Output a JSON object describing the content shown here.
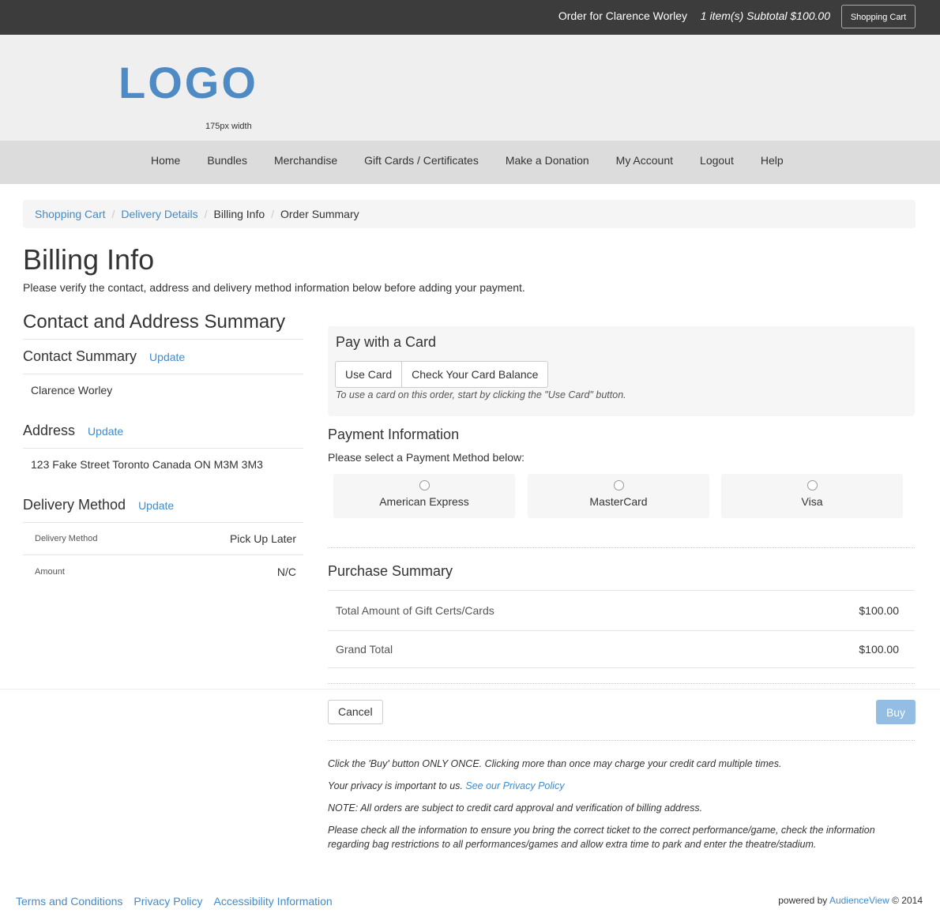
{
  "topbar": {
    "order_for": "Order for Clarence Worley",
    "subtotal": "1 item(s) Subtotal $100.00",
    "cart_button": "Shopping Cart"
  },
  "header": {
    "logo": "LOGO",
    "logo_note": "175px width"
  },
  "nav": {
    "items": [
      "Home",
      "Bundles",
      "Merchandise",
      "Gift Cards / Certificates",
      "Make a Donation",
      "My Account",
      "Logout",
      "Help"
    ]
  },
  "breadcrumb": {
    "items": [
      "Shopping Cart",
      "Delivery Details",
      "Billing Info",
      "Order Summary"
    ],
    "separator": "/"
  },
  "page": {
    "title": "Billing Info",
    "lead": "Please verify the contact, address and delivery method information below before adding your payment."
  },
  "summary": {
    "heading": "Contact and Address Summary",
    "contact": {
      "label": "Contact Summary",
      "update": "Update",
      "value": "Clarence Worley"
    },
    "address": {
      "label": "Address",
      "update": "Update",
      "value": "123 Fake Street Toronto Canada ON M3M 3M3"
    },
    "delivery": {
      "label": "Delivery Method",
      "update": "Update",
      "rows": [
        {
          "key": "Delivery Method",
          "value": "Pick Up Later"
        },
        {
          "key": "Amount",
          "value": "N/C"
        }
      ]
    }
  },
  "card": {
    "heading": "Pay with a Card",
    "use_card": "Use Card",
    "check_balance": "Check Your Card Balance",
    "hint": "To use a card on this order, start by clicking the \"Use Card\" button."
  },
  "payment": {
    "heading": "Payment Information",
    "sub": "Please select a Payment Method below:",
    "methods": [
      "American Express",
      "MasterCard",
      "Visa"
    ]
  },
  "purchase": {
    "heading": "Purchase Summary",
    "rows": [
      {
        "key": "Total Amount of Gift Certs/Cards",
        "value": "$100.00"
      },
      {
        "key": "Grand Total",
        "value": "$100.00"
      }
    ]
  },
  "actions": {
    "cancel": "Cancel",
    "buy": "Buy"
  },
  "notes": {
    "once": "Click the 'Buy' button ONLY ONCE. Clicking more than once may charge your credit card multiple times.",
    "privacy_prefix": "Your privacy is important to us.",
    "privacy_link": "See our Privacy Policy",
    "approval": "NOTE: All orders are subject to credit card approval and verification of billing address.",
    "check": "Please check all the information to ensure you bring the correct ticket to the correct performance/game, check the information regarding bag restrictions to all performances/games and allow extra time to park and enter the theatre/stadium."
  },
  "footer": {
    "links": [
      "Terms and Conditions",
      "Privacy Policy",
      "Accessibility Information"
    ],
    "powered_prefix": "powered by",
    "powered_brand": "AudienceView",
    "powered_suffix": "© 2014"
  },
  "colors": {
    "link": "#428bca",
    "topbar": "#3c3c3c",
    "logo": "#4e8bc5",
    "buy": "#94bde4"
  }
}
